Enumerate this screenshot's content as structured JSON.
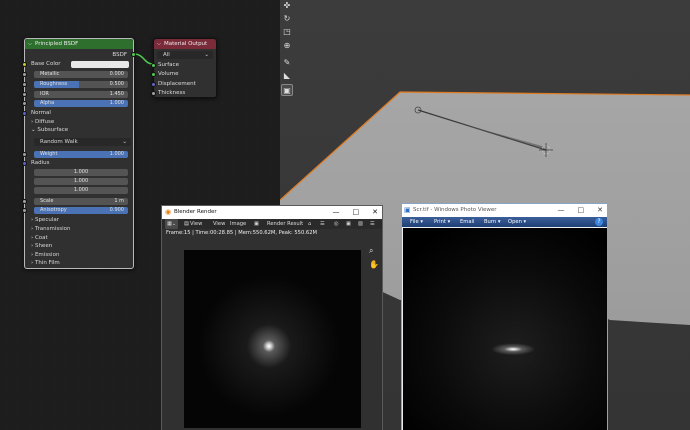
{
  "bsdf_node": {
    "title": "Principled BSDF",
    "output_socket": "BSDF",
    "base_color_label": "Base Color",
    "metallic": {
      "label": "Metallic",
      "value": "0.000"
    },
    "roughness": {
      "label": "Roughness",
      "value": "0.500"
    },
    "ior": {
      "label": "IOR",
      "value": "1.450"
    },
    "alpha": {
      "label": "Alpha",
      "value": "1.000"
    },
    "normal_label": "Normal",
    "diffuse_label": "Diffuse",
    "subsurface_label": "Subsurface",
    "subsurface_method": "Random Walk",
    "weight": {
      "label": "Weight",
      "value": "1.000"
    },
    "radius_label": "Radius",
    "radius_values": [
      "1.000",
      "1.000",
      "1.000"
    ],
    "scale": {
      "label": "Scale",
      "value": "1 m"
    },
    "anisotropy": {
      "label": "Anisotropy",
      "value": "0.900"
    },
    "panels": [
      "Specular",
      "Transmission",
      "Coat",
      "Sheen",
      "Emission",
      "Thin Film"
    ]
  },
  "output_node": {
    "title": "Material Output",
    "target": "All",
    "sockets": [
      "Surface",
      "Volume",
      "Displacement",
      "Thickness"
    ]
  },
  "render_window": {
    "title": "Blender Render",
    "menu": [
      "View",
      "View",
      "Image"
    ],
    "slot": "Render Result",
    "stats": "Frame:15 | Time:00:28.85 | Mem:550.62M, Peak: 550.62M"
  },
  "photo_window": {
    "title": "Scr.tif - Windows Photo Viewer",
    "menu": [
      "File",
      "Print",
      "Email",
      "Burn",
      "Open"
    ]
  },
  "colors": {
    "bsdf_header": "#2e6f2e",
    "output_header": "#7a2a38",
    "field_blue": "#4a72b4",
    "floor": "#a5a5a5",
    "selection_orange": "#e07a1f"
  }
}
